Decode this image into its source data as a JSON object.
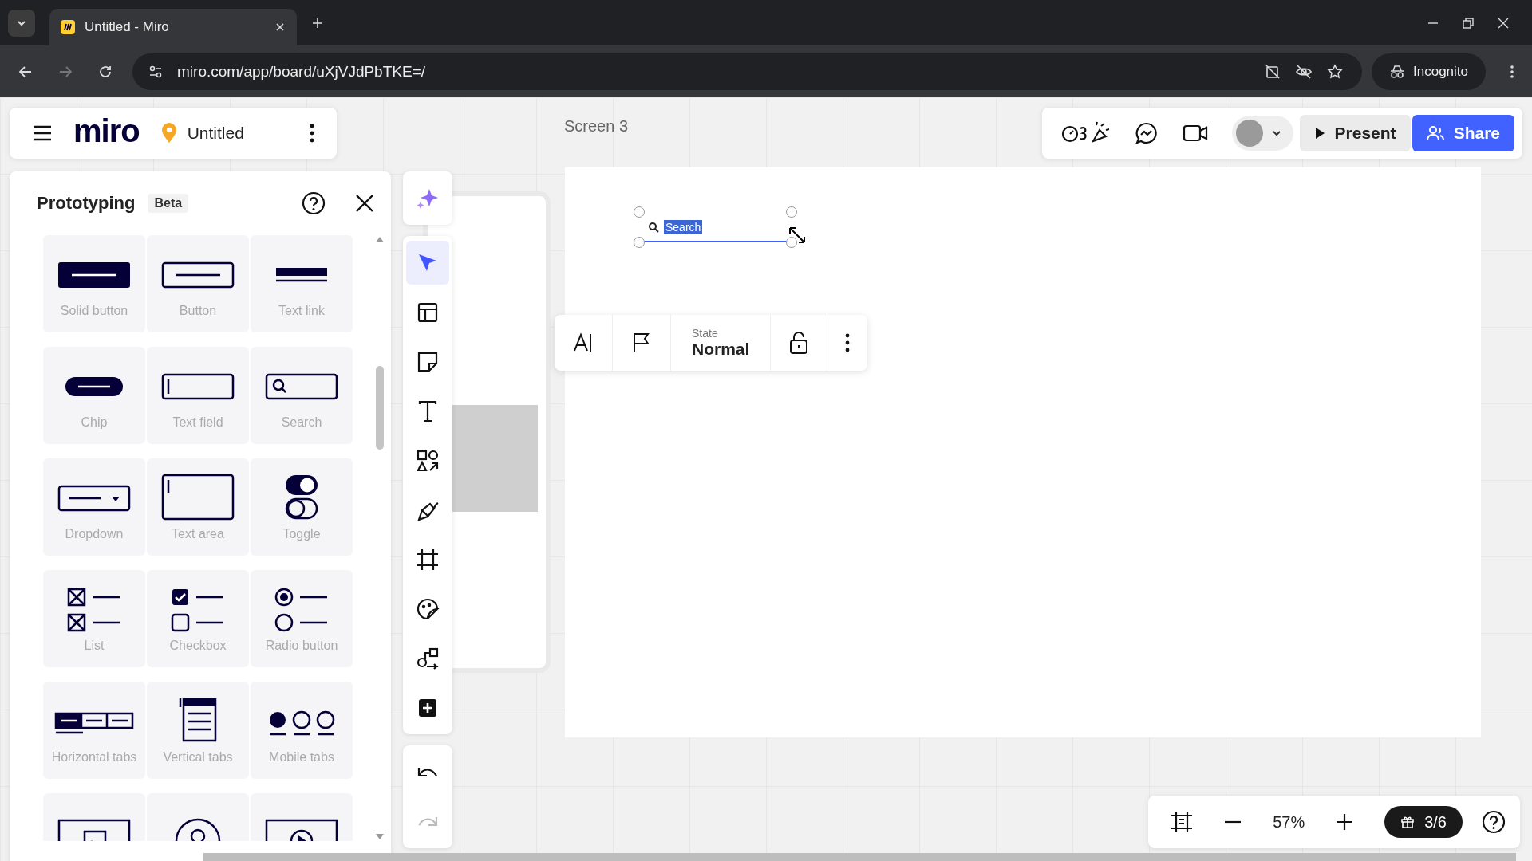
{
  "browser": {
    "tab_title": "Untitled - Miro",
    "url": "miro.com/app/board/uXjVJdPbTKE=/",
    "profile_label": "Incognito",
    "forward_disabled": true
  },
  "board_menu": {
    "logo": "miro",
    "title": "Untitled"
  },
  "canvas": {
    "frame_label": "Screen 3",
    "search_widget": {
      "text": "Search",
      "selected": true
    }
  },
  "top_actions": {
    "present": "Present",
    "share": "Share"
  },
  "panel": {
    "title": "Prototyping",
    "badge": "Beta",
    "items": [
      {
        "kind": "solid-button",
        "label": "Solid button"
      },
      {
        "kind": "button",
        "label": "Button"
      },
      {
        "kind": "text-link",
        "label": "Text link"
      },
      {
        "kind": "chip",
        "label": "Chip"
      },
      {
        "kind": "text-field",
        "label": "Text field"
      },
      {
        "kind": "search",
        "label": "Search"
      },
      {
        "kind": "dropdown",
        "label": "Dropdown"
      },
      {
        "kind": "text-area",
        "label": "Text area"
      },
      {
        "kind": "toggle",
        "label": "Toggle"
      },
      {
        "kind": "list",
        "label": "List"
      },
      {
        "kind": "checkbox",
        "label": "Checkbox"
      },
      {
        "kind": "radio",
        "label": "Radio button"
      },
      {
        "kind": "horizontal-tabs",
        "label": "Horizontal tabs"
      },
      {
        "kind": "vertical-tabs",
        "label": "Vertical tabs"
      },
      {
        "kind": "mobile-tabs",
        "label": "Mobile tabs"
      },
      {
        "kind": "image"
      },
      {
        "kind": "avatar"
      },
      {
        "kind": "video"
      }
    ]
  },
  "tools": [
    {
      "kind": "select",
      "selected": true
    },
    {
      "kind": "templates",
      "selected": false
    },
    {
      "kind": "sticky",
      "selected": false
    },
    {
      "kind": "text",
      "selected": false
    },
    {
      "kind": "shapes",
      "selected": false
    },
    {
      "kind": "pen",
      "selected": false
    },
    {
      "kind": "frame",
      "selected": false
    },
    {
      "kind": "stickers",
      "selected": false
    },
    {
      "kind": "diagram",
      "selected": false
    },
    {
      "kind": "more",
      "selected": false
    }
  ],
  "history": {
    "undo_disabled": false,
    "redo_disabled": true
  },
  "context_toolbar": {
    "state_label": "State",
    "state_value": "Normal"
  },
  "zoom_bar": {
    "zoom": "57%",
    "progress": "3/6"
  }
}
